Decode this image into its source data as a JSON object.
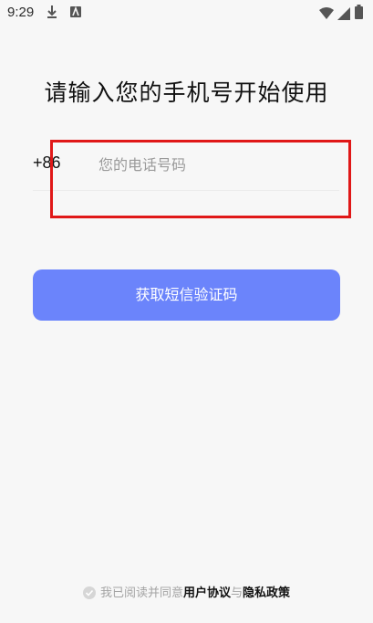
{
  "status_bar": {
    "time": "9:29",
    "icons": [
      "download-icon",
      "app-a-icon",
      "wifi-icon",
      "signal-icon",
      "battery-icon"
    ]
  },
  "login": {
    "title": "请输入您的手机号开始使用",
    "country_code": "+86",
    "phone_value": "",
    "phone_placeholder": "您的电话号码",
    "button_label": "获取短信验证码"
  },
  "agreement": {
    "prefix": "我已阅读并同意",
    "user_agreement": "用户协议",
    "connector": "与",
    "privacy_policy": "隐私政策"
  },
  "colors": {
    "button": "#6b84fb",
    "highlight": "#e01818",
    "background": "#f7f7f7"
  }
}
